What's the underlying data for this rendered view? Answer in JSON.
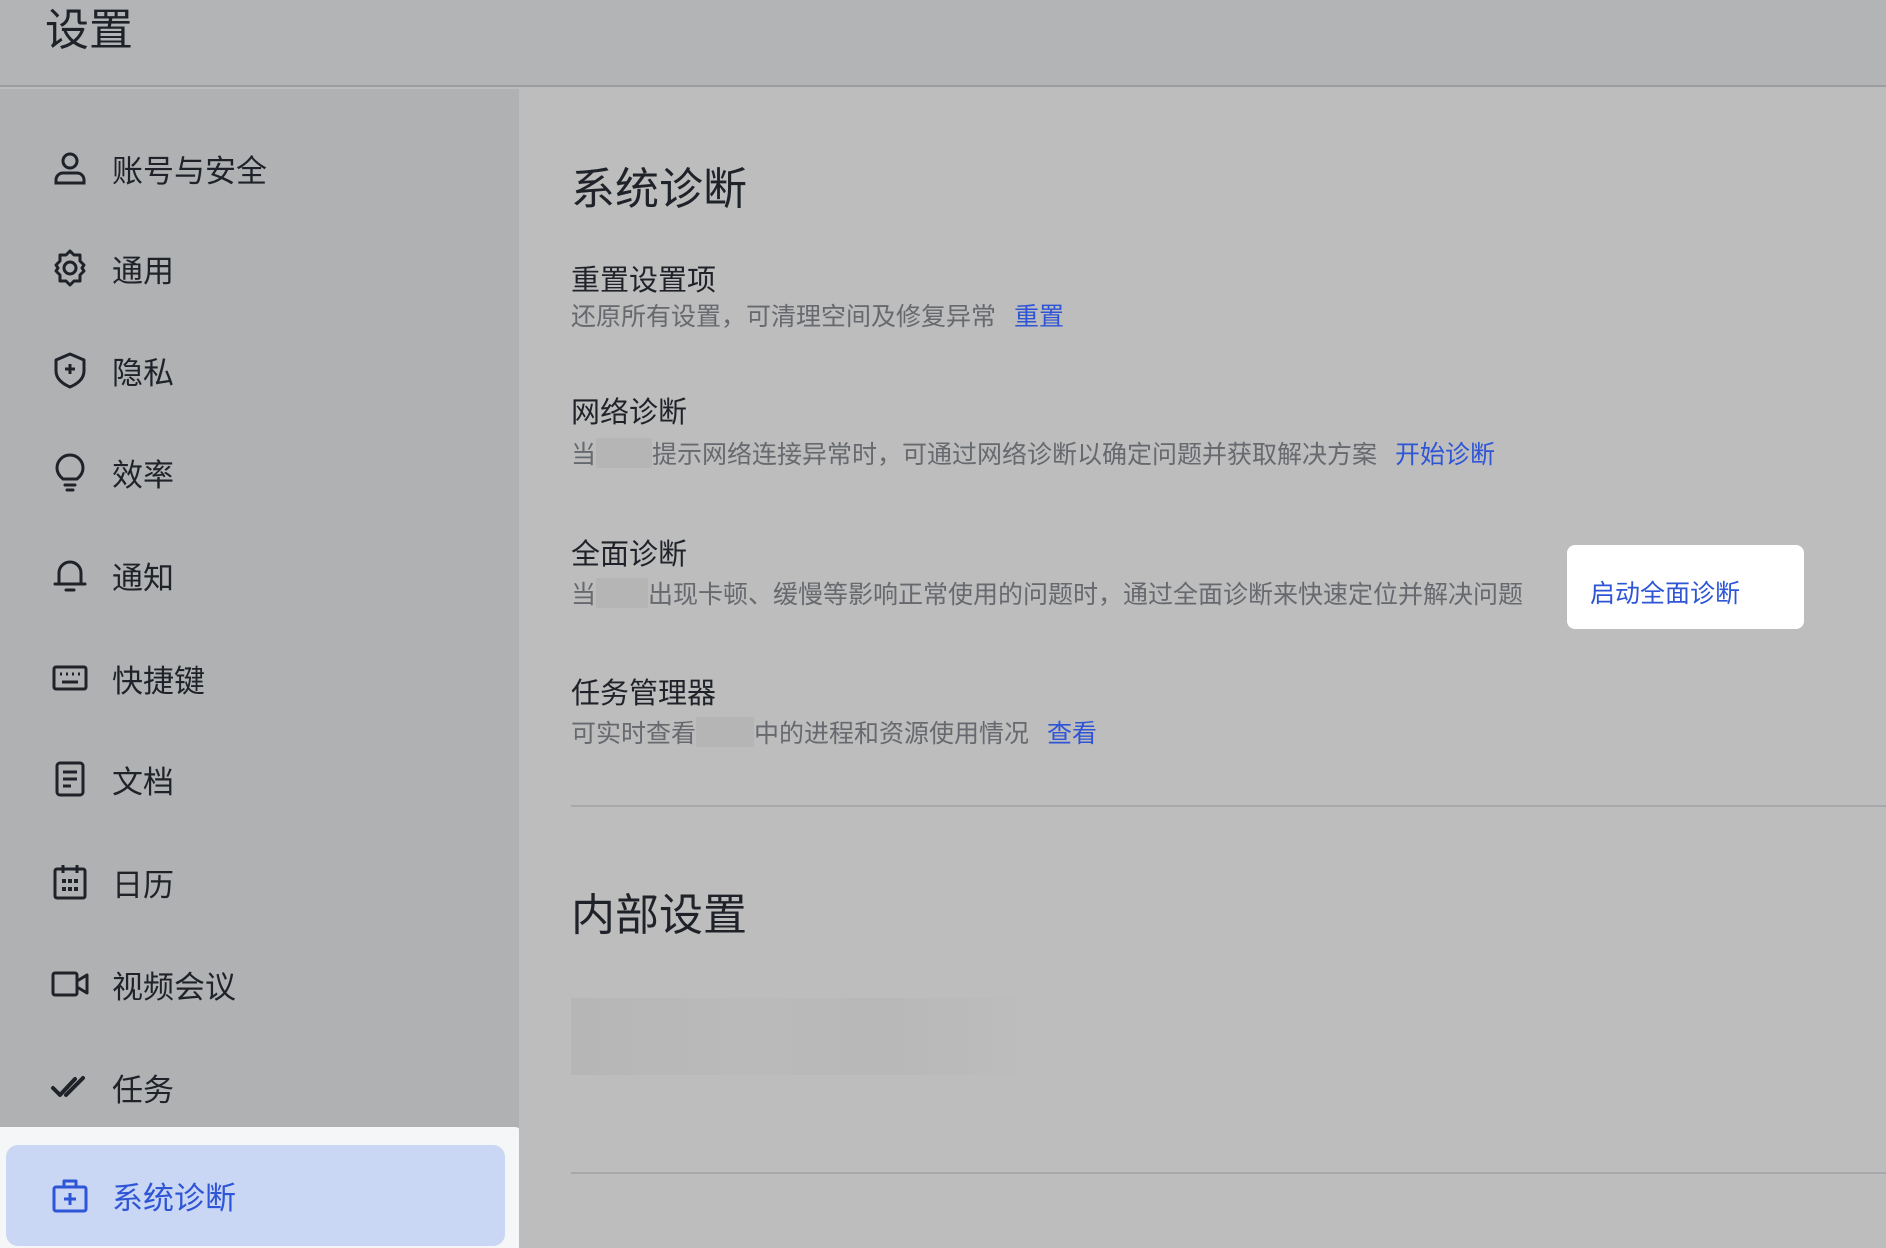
{
  "header": {
    "title": "设置"
  },
  "sidebar": {
    "items": [
      {
        "label": "账号与安全",
        "icon": "user-icon"
      },
      {
        "label": "通用",
        "icon": "gear-icon"
      },
      {
        "label": "隐私",
        "icon": "shield-plus-icon"
      },
      {
        "label": "效率",
        "icon": "lightbulb-icon"
      },
      {
        "label": "通知",
        "icon": "bell-icon"
      },
      {
        "label": "快捷键",
        "icon": "keyboard-icon"
      },
      {
        "label": "文档",
        "icon": "document-icon"
      },
      {
        "label": "日历",
        "icon": "calendar-icon"
      },
      {
        "label": "视频会议",
        "icon": "video-camera-icon"
      },
      {
        "label": "任务",
        "icon": "double-check-icon"
      },
      {
        "label": "系统诊断",
        "icon": "medical-kit-icon",
        "active": true
      }
    ]
  },
  "main": {
    "section1_title": "系统诊断",
    "reset": {
      "title": "重置设置项",
      "desc": "还原所有设置，可清理空间及修复异常",
      "link": "重置"
    },
    "network": {
      "title": "网络诊断",
      "desc_prefix": "当",
      "desc_suffix": "提示网络连接异常时，可通过网络诊断以确定问题并获取解决方案",
      "link": "开始诊断"
    },
    "full": {
      "title": "全面诊断",
      "desc_prefix": "当",
      "desc_suffix": "出现卡顿、缓慢等影响正常使用的问题时，通过全面诊断来快速定位并解决问题",
      "link": "启动全面诊断"
    },
    "task_manager": {
      "title": "任务管理器",
      "desc_prefix": "可实时查看",
      "desc_suffix": "中的进程和资源使用情况",
      "link": "查看"
    },
    "section2_title": "内部设置"
  },
  "colors": {
    "accent": "#2d55d6",
    "active_bg": "#c9d6f4"
  }
}
